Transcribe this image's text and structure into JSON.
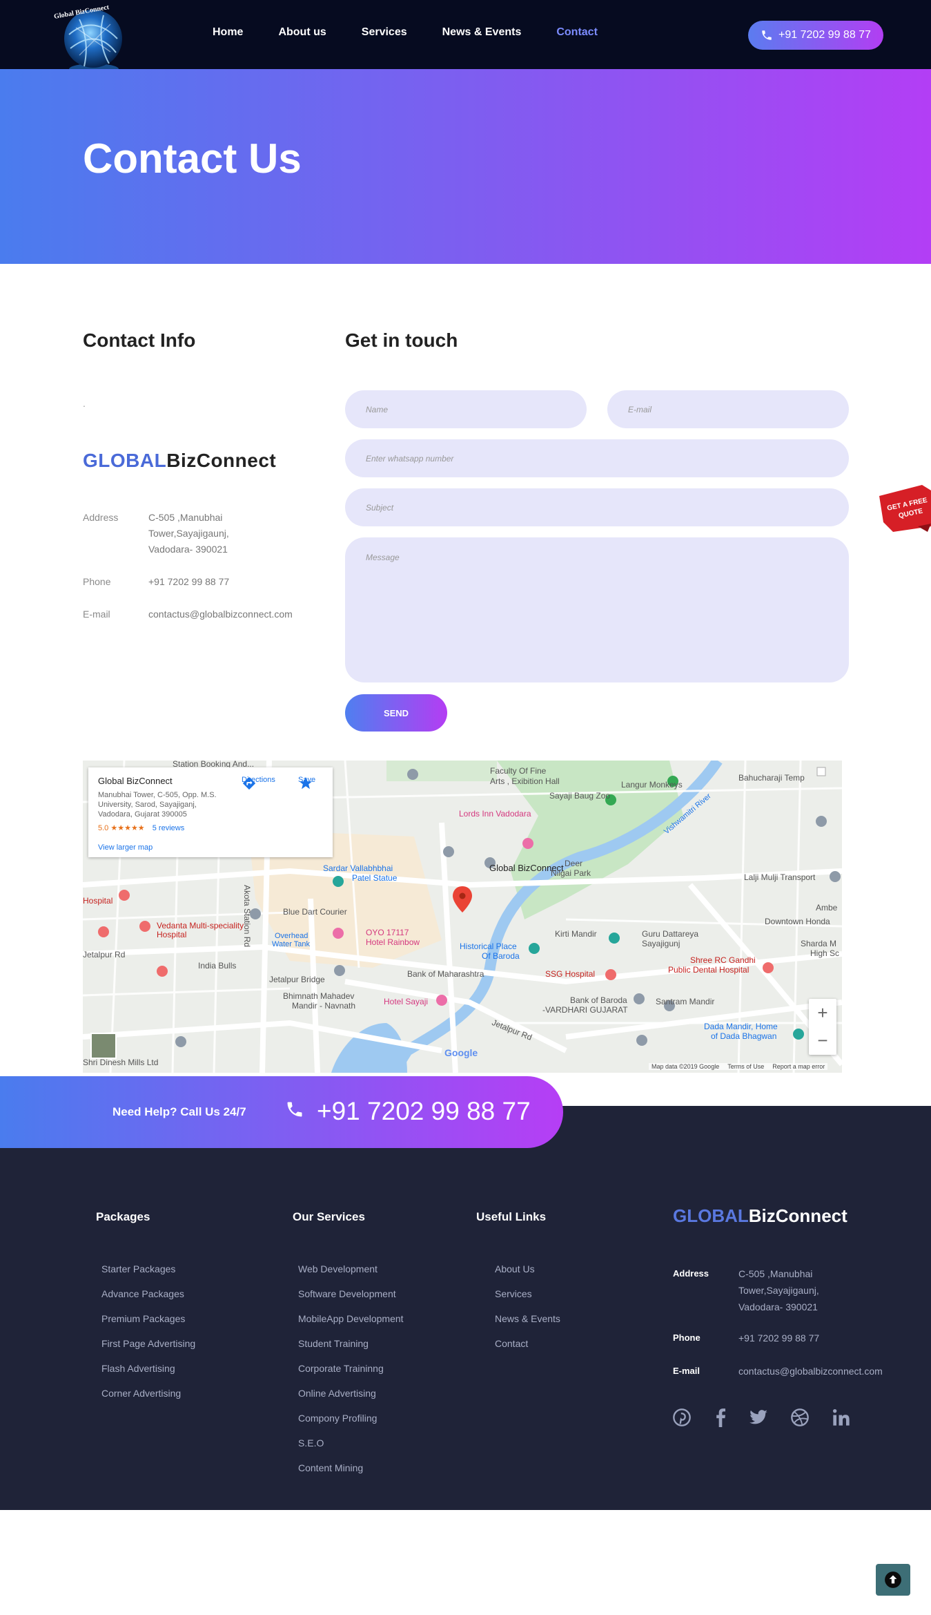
{
  "header": {
    "logo_text": "Global BizConnect",
    "nav": [
      {
        "label": "Home",
        "active": false
      },
      {
        "label": "About us",
        "active": false
      },
      {
        "label": "Services",
        "active": false
      },
      {
        "label": "News & Events",
        "active": false
      },
      {
        "label": "Contact",
        "active": true
      }
    ],
    "phone": "+91 7202 99 88 77"
  },
  "hero": {
    "title": "Contact Us"
  },
  "contact_info": {
    "heading": "Contact Info",
    "dot": ".",
    "brand_part1": "GLOBAL",
    "brand_part2": "BizConnect",
    "address_label": "Address",
    "address_lines": [
      "C-505 ,Manubhai",
      "Tower,Sayajigaunj,",
      "Vadodara- 390021"
    ],
    "phone_label": "Phone",
    "phone": "+91 7202 99 88 77",
    "email_label": "E-mail",
    "email": "contactus@globalbizconnect.com"
  },
  "form": {
    "heading": "Get in touch",
    "name_placeholder": "Name",
    "email_placeholder": "E-mail",
    "whatsapp_placeholder": "Enter whatsapp number",
    "subject_placeholder": "Subject",
    "message_placeholder": "Message",
    "send_label": "SEND"
  },
  "quote_badge": {
    "line1": "GET A FREE",
    "line2": "QUOTE"
  },
  "map": {
    "card_title": "Global BizConnect",
    "card_address": "Manubhai Tower, C-505, Opp. M.S. University, Sarod, Sayajiganj, Vadodara, Gujarat 390005",
    "rating": "5.0",
    "stars": "★★★★★",
    "reviews": "5 reviews",
    "larger_map": "View larger map",
    "directions": "Directions",
    "save": "Save",
    "pin_label": "Global BizConnect",
    "labels": [
      {
        "text": "Faculty Of Fine",
        "cls": ""
      },
      {
        "text": "Arts , Exibition Hall",
        "cls": ""
      },
      {
        "text": "Langur Monkeys",
        "cls": ""
      },
      {
        "text": "Sayaji Baug Zoo",
        "cls": ""
      },
      {
        "text": "Lords Inn Vadodara",
        "cls": "pink"
      },
      {
        "text": "Deer",
        "cls": ""
      },
      {
        "text": "Nilgai Park",
        "cls": ""
      },
      {
        "text": "Sardar Vallabhbhai",
        "cls": "blue"
      },
      {
        "text": "Patel Statue",
        "cls": "blue"
      },
      {
        "text": "Blue Dart Courier",
        "cls": ""
      },
      {
        "text": "Vedanta Multi-speciality",
        "cls": "red"
      },
      {
        "text": "Hospital",
        "cls": "red"
      },
      {
        "text": "OYO 17117",
        "cls": "pink"
      },
      {
        "text": "Hotel Rainbow",
        "cls": "pink"
      },
      {
        "text": "Historical Place",
        "cls": "blue"
      },
      {
        "text": "Of Baroda",
        "cls": "blue"
      },
      {
        "text": "Kirti Mandir",
        "cls": ""
      },
      {
        "text": "Guru Dattareya",
        "cls": ""
      },
      {
        "text": "Sayajigunj",
        "cls": ""
      },
      {
        "text": "India Bulls",
        "cls": ""
      },
      {
        "text": "Bank of Maharashtra",
        "cls": ""
      },
      {
        "text": "SSG Hospital",
        "cls": "red"
      },
      {
        "text": "Bhimnath Mahadev",
        "cls": ""
      },
      {
        "text": "Mandir - Navnath",
        "cls": ""
      },
      {
        "text": "Hotel Sayaji",
        "cls": "pink"
      },
      {
        "text": "Bank of Baroda",
        "cls": ""
      },
      {
        "text": "-VARDHARI GUJARAT",
        "cls": ""
      },
      {
        "text": "Santram Mandir",
        "cls": ""
      },
      {
        "text": "Shree RC Gandhi",
        "cls": "red"
      },
      {
        "text": "Public Dental Hospital",
        "cls": "red"
      },
      {
        "text": "Dada Mandir, Home",
        "cls": "blue"
      },
      {
        "text": "of Dada Bhagwan",
        "cls": "blue"
      },
      {
        "text": "Lalji Mulji Transport",
        "cls": ""
      },
      {
        "text": "Downtown Honda",
        "cls": ""
      },
      {
        "text": "Bahucharaji Temp",
        "cls": ""
      },
      {
        "text": "Jetalpur Rd",
        "cls": ""
      },
      {
        "text": "Jetalpur Bridge",
        "cls": ""
      },
      {
        "text": "Akota Station Rd",
        "cls": ""
      },
      {
        "text": "Overhead",
        "cls": "blue"
      },
      {
        "text": "Water Tank",
        "cls": "blue"
      },
      {
        "text": "Shri Dinesh Mills Ltd",
        "cls": ""
      },
      {
        "text": "Vishwamitri River",
        "cls": "blue"
      },
      {
        "text": "Hospital",
        "cls": "red"
      },
      {
        "text": "Jetalpur Rd",
        "cls": ""
      },
      {
        "text": "Ambe",
        "cls": ""
      },
      {
        "text": "Sharda M",
        "cls": ""
      },
      {
        "text": "High Sc",
        "cls": ""
      },
      {
        "text": "Station Booking And...",
        "cls": ""
      }
    ],
    "google": "Google",
    "footer_items": [
      "Map data ©2019 Google",
      "Terms of Use",
      "Report a map error"
    ],
    "zoom_in": "+",
    "zoom_out": "−"
  },
  "callbar": {
    "need": "Need Help? Call Us 24/7",
    "number": "+91 7202 99 88 77"
  },
  "footer": {
    "packages": {
      "heading": "Packages",
      "items": [
        "Starter Packages",
        "Advance Packages",
        "Premium Packages",
        "First Page Advertising",
        "Flash Advertising",
        "Corner Advertising"
      ]
    },
    "services": {
      "heading": "Our Services",
      "items": [
        "Web Development",
        "Software Development",
        "MobileApp Development",
        "Student Training",
        "Corporate Traininng",
        "Online Advertising",
        "Compony Profiling",
        "S.E.O",
        "Content Mining"
      ]
    },
    "links": {
      "heading": "Useful Links",
      "items": [
        "About Us",
        "Services",
        "News & Events",
        "Contact"
      ]
    },
    "brand_part1": "GLOBAL",
    "brand_part2": "BizConnect",
    "address_label": "Address",
    "address_lines": [
      "C-505 ,Manubhai",
      "Tower,Sayajigaunj,",
      "Vadodara- 390021"
    ],
    "phone_label": "Phone",
    "phone": "+91 7202 99 88 77",
    "email_label": "E-mail",
    "email": "contactus@globalbizconnect.com"
  }
}
